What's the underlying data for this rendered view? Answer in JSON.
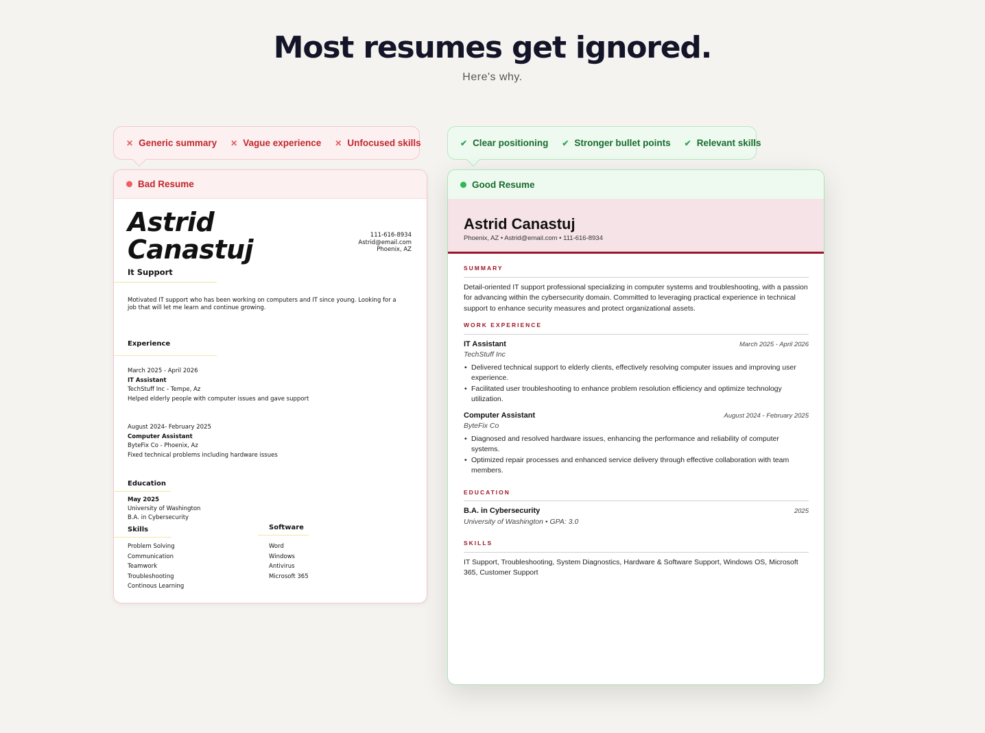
{
  "hero": {
    "title": "Most resumes get ignored.",
    "subtitle": "Here's why."
  },
  "bad": {
    "tags": [
      "Generic summary",
      "Vague experience",
      "Unfocused skills"
    ],
    "header_label": "Bad Resume",
    "resume": {
      "name_line1": "Astrid",
      "name_line2": "Canastuj",
      "phone": "111-616-8934",
      "email": "Astrid@email.com",
      "location": "Phoenix, AZ",
      "role": "It Support",
      "summary": "Motivated IT support who has been working on computers and IT since young. Looking for a job that will let me learn and continue growing.",
      "experience_heading": "Experience",
      "jobs": [
        {
          "dates": "March 2025 - April 2026",
          "title": "IT Assistant",
          "company": "TechStuff Inc - Tempe, Az",
          "desc": "Helped elderly people with computer issues and gave support"
        },
        {
          "dates": "August 2024- February 2025",
          "title": "Computer Assistant",
          "company": "ByteFix Co - Phoenix, Az",
          "desc": "Fixed technical problems including hardware issues"
        }
      ],
      "education_heading": "Education",
      "education": {
        "date": "May 2025",
        "school": "University of Washington",
        "degree": "B.A. in Cybersecurity"
      },
      "skills_heading": "Skills",
      "skills": [
        "Problem Solving",
        "Communication",
        "Teamwork",
        "Troubleshooting",
        "Continous Learning"
      ],
      "software_heading": "Software",
      "software": [
        "Word",
        "Windows",
        "Antivirus",
        "Microsoft 365"
      ]
    }
  },
  "good": {
    "tags": [
      "Clear positioning",
      "Stronger bullet points",
      "Relevant skills"
    ],
    "header_label": "Good Resume",
    "resume": {
      "name": "Astrid Canastuj",
      "meta": "Phoenix, AZ • Astrid@email.com • 111-616-8934",
      "summary_heading": "SUMMARY",
      "summary": "Detail-oriented IT support professional specializing in computer systems and troubleshooting, with a passion for advancing within the cybersecurity domain. Committed to leveraging practical experience in technical support to enhance security measures and protect organizational assets.",
      "work_heading": "WORK EXPERIENCE",
      "jobs": [
        {
          "title": "IT Assistant",
          "dates": "March 2025 - April 2026",
          "company": "TechStuff Inc",
          "bullets": [
            "Delivered technical support to elderly clients, effectively resolving computer issues and improving user experience.",
            "Facilitated user troubleshooting to enhance problem resolution efficiency and optimize technology utilization."
          ]
        },
        {
          "title": "Computer Assistant",
          "dates": "August 2024 - February 2025",
          "company": "ByteFix Co",
          "bullets": [
            "Diagnosed and resolved hardware issues, enhancing the performance and reliability of computer systems.",
            "Optimized repair processes and enhanced service delivery through effective collaboration with team mem­bers."
          ]
        }
      ],
      "education_heading": "EDUCATION",
      "degree": "B.A. in Cybersecurity",
      "grad_year": "2025",
      "school": "University of Washington • GPA: 3.0",
      "skills_heading": "SKILLS",
      "skills": "IT Support, Troubleshooting, System Diagnostics, Hardware & Software Support, Windows OS, Microsoft 365, Customer Support"
    }
  }
}
